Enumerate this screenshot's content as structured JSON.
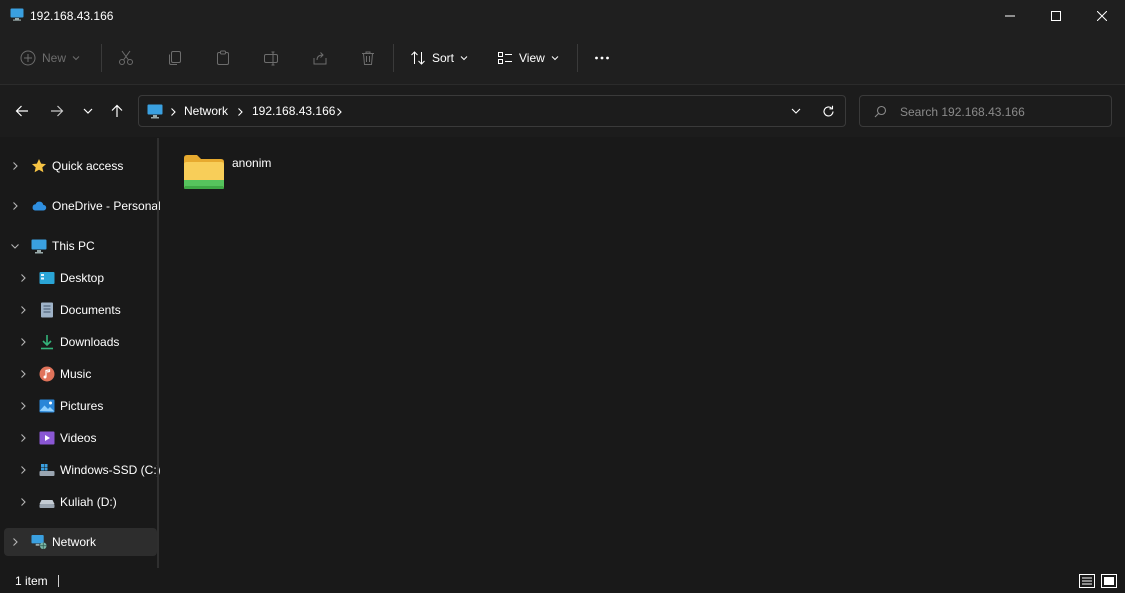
{
  "window": {
    "title": "192.168.43.166",
    "minimize_icon": "minimize-icon",
    "maximize_icon": "maximize-icon",
    "close_icon": "close-icon"
  },
  "toolbar": {
    "new_label": "New",
    "sort_label": "Sort",
    "view_label": "View",
    "icons": [
      "plus-icon",
      "cut-icon",
      "copy-icon",
      "paste-icon",
      "rename-icon",
      "share-icon",
      "delete-icon",
      "sort-icon",
      "view-icon",
      "more-icon"
    ]
  },
  "address": {
    "breadcrumbs": [
      "Network",
      "192.168.43.166"
    ],
    "icon": "monitor-icon"
  },
  "search": {
    "placeholder": "Search 192.168.43.166"
  },
  "sidebar": {
    "items": [
      {
        "label": "Quick access",
        "icon": "star-icon"
      },
      {
        "label": "OneDrive - Personal",
        "icon": "cloud-icon"
      },
      {
        "label": "This PC",
        "icon": "monitor-icon"
      },
      {
        "label": "Desktop",
        "icon": "desktop-icon"
      },
      {
        "label": "Documents",
        "icon": "documents-icon"
      },
      {
        "label": "Downloads",
        "icon": "downloads-icon"
      },
      {
        "label": "Music",
        "icon": "music-icon"
      },
      {
        "label": "Pictures",
        "icon": "pictures-icon"
      },
      {
        "label": "Videos",
        "icon": "videos-icon"
      },
      {
        "label": "Windows-SSD (C:)",
        "icon": "windows-drive-icon"
      },
      {
        "label": "Kuliah (D:)",
        "icon": "drive-icon"
      },
      {
        "label": "Network",
        "icon": "network-icon"
      }
    ]
  },
  "content": {
    "items": [
      {
        "name": "anonim",
        "icon": "shared-folder-icon"
      }
    ]
  },
  "status": {
    "count_text": "1 item"
  },
  "colors": {
    "background": "#191919",
    "accent": "#60cdff",
    "folder": "#f3c14b"
  }
}
